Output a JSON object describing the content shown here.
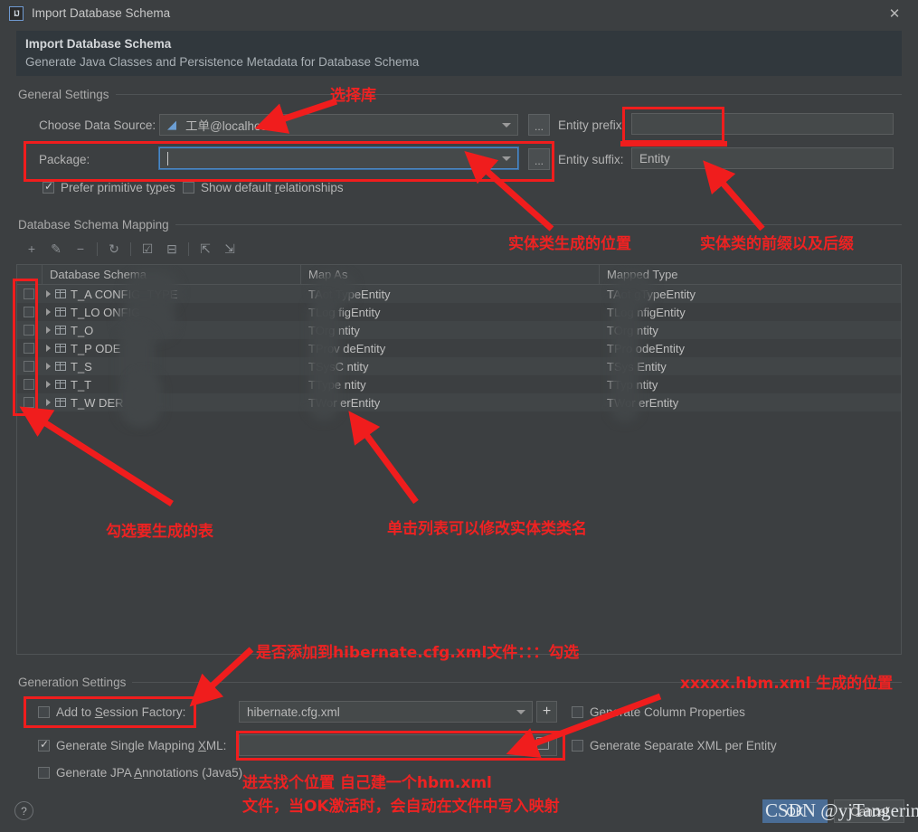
{
  "window": {
    "title": "Import Database Schema",
    "logo_text": "IJ",
    "close_icon": "close-icon"
  },
  "banner": {
    "title": "Import Database Schema",
    "subtitle": "Generate Java Classes and Persistence Metadata for Database Schema"
  },
  "general_settings": {
    "group_label": "General Settings",
    "data_source_label": "Choose Data Source:",
    "data_source_value": "工单@localhost",
    "package_label": "Package:",
    "package_value": "",
    "entity_prefix_label": "Entity prefix:",
    "entity_prefix_value": "",
    "entity_suffix_label": "Entity suffix:",
    "entity_suffix_value": "Entity",
    "ellipsis_label": "...",
    "prefer_primitive_types": "Prefer primitive types",
    "prefer_primitive_types_checked": true,
    "show_default_relationships": "Show default relationships",
    "show_default_relationships_checked": false
  },
  "mapping": {
    "group_label": "Database Schema Mapping",
    "toolbar": [
      {
        "name": "add-icon",
        "glyph": "+"
      },
      {
        "name": "edit-pencil-icon",
        "glyph": "✎"
      },
      {
        "name": "remove-icon",
        "glyph": "−"
      },
      {
        "name": "refresh-icon",
        "glyph": "↻"
      },
      {
        "name": "select-all-icon",
        "glyph": "☑"
      },
      {
        "name": "deselect-all-icon",
        "glyph": "⊟"
      },
      {
        "name": "expand-all-icon",
        "glyph": "⇱"
      },
      {
        "name": "collapse-all-icon",
        "glyph": "⇲"
      }
    ],
    "columns": [
      "Database Schema",
      "Map As",
      "Mapped Type"
    ],
    "rows": [
      {
        "checked": false,
        "schema": "T_A        CONFIG_TYPE",
        "map_as": "TAot            TypeEntity",
        "mapped_type": "TAot        gTypeEntity"
      },
      {
        "checked": false,
        "schema": "T_LO        ONFIG",
        "map_as": "TLog            figEntity",
        "mapped_type": "TLog        nfigEntity"
      },
      {
        "checked": false,
        "schema": "T_O",
        "map_as": "TOrg            ntity",
        "mapped_type": "TOrg        ntity"
      },
      {
        "checked": false,
        "schema": "T_P         ODE",
        "map_as": "TProv          deEntity",
        "mapped_type": "TPro        odeEntity"
      },
      {
        "checked": false,
        "schema": "T_S",
        "map_as": "TSysC          ntity",
        "mapped_type": "TSys        Entity"
      },
      {
        "checked": false,
        "schema": "T_T",
        "map_as": "TType          ntity",
        "mapped_type": "TTyp        ntity"
      },
      {
        "checked": false,
        "schema": "T_W         DER",
        "map_as": "TWor            erEntity",
        "mapped_type": "TWor        erEntity"
      }
    ]
  },
  "generation_settings": {
    "group_label": "Generation Settings",
    "add_to_session_factory": "Add to Session Factory:",
    "add_to_session_factory_checked": false,
    "session_factory_value": "hibernate.cfg.xml",
    "add_button_label": "+",
    "generate_single_mapping_xml": "Generate Single Mapping XML:",
    "generate_single_mapping_xml_checked": true,
    "mapping_xml_path": "",
    "generate_jpa_annotations": "Generate JPA Annotations (Java5)",
    "generate_jpa_annotations_checked": false,
    "generate_column_properties": "Generate Column Properties",
    "generate_column_properties_checked": false,
    "generate_separate_xml": "Generate Separate XML per Entity",
    "generate_separate_xml_checked": false
  },
  "footer": {
    "help_label": "?",
    "ok_label": "OK",
    "cancel_label": "Cancel",
    "watermark": "CSDN @yjTangerine"
  },
  "annotations": [
    {
      "id": "a1",
      "text": "选择库"
    },
    {
      "id": "a2",
      "text": "实体类生成的位置"
    },
    {
      "id": "a3",
      "text": "实体类的前缀以及后缀"
    },
    {
      "id": "a4",
      "text": "勾选要生成的表"
    },
    {
      "id": "a5",
      "text": "单击列表可以修改实体类类名"
    },
    {
      "id": "a6",
      "text": "是否添加到hibernate.cfg.xml文件：：：勾选"
    },
    {
      "id": "a7",
      "text": "xxxxx.hbm.xml 生成的位置"
    },
    {
      "id": "a8",
      "text": "进去找个位置 自己建一个hbm.xml"
    },
    {
      "id": "a9",
      "text": "文件，当OK激活时，会自动在文件中写入映射"
    }
  ],
  "colors": {
    "dialog_bg": "#3c3f41",
    "banner_bg": "#31383d",
    "field_bg": "#45494a",
    "annotation_red": "#ee2222",
    "focus_blue": "#4a88c7",
    "primary_button": "#4a6d96"
  }
}
